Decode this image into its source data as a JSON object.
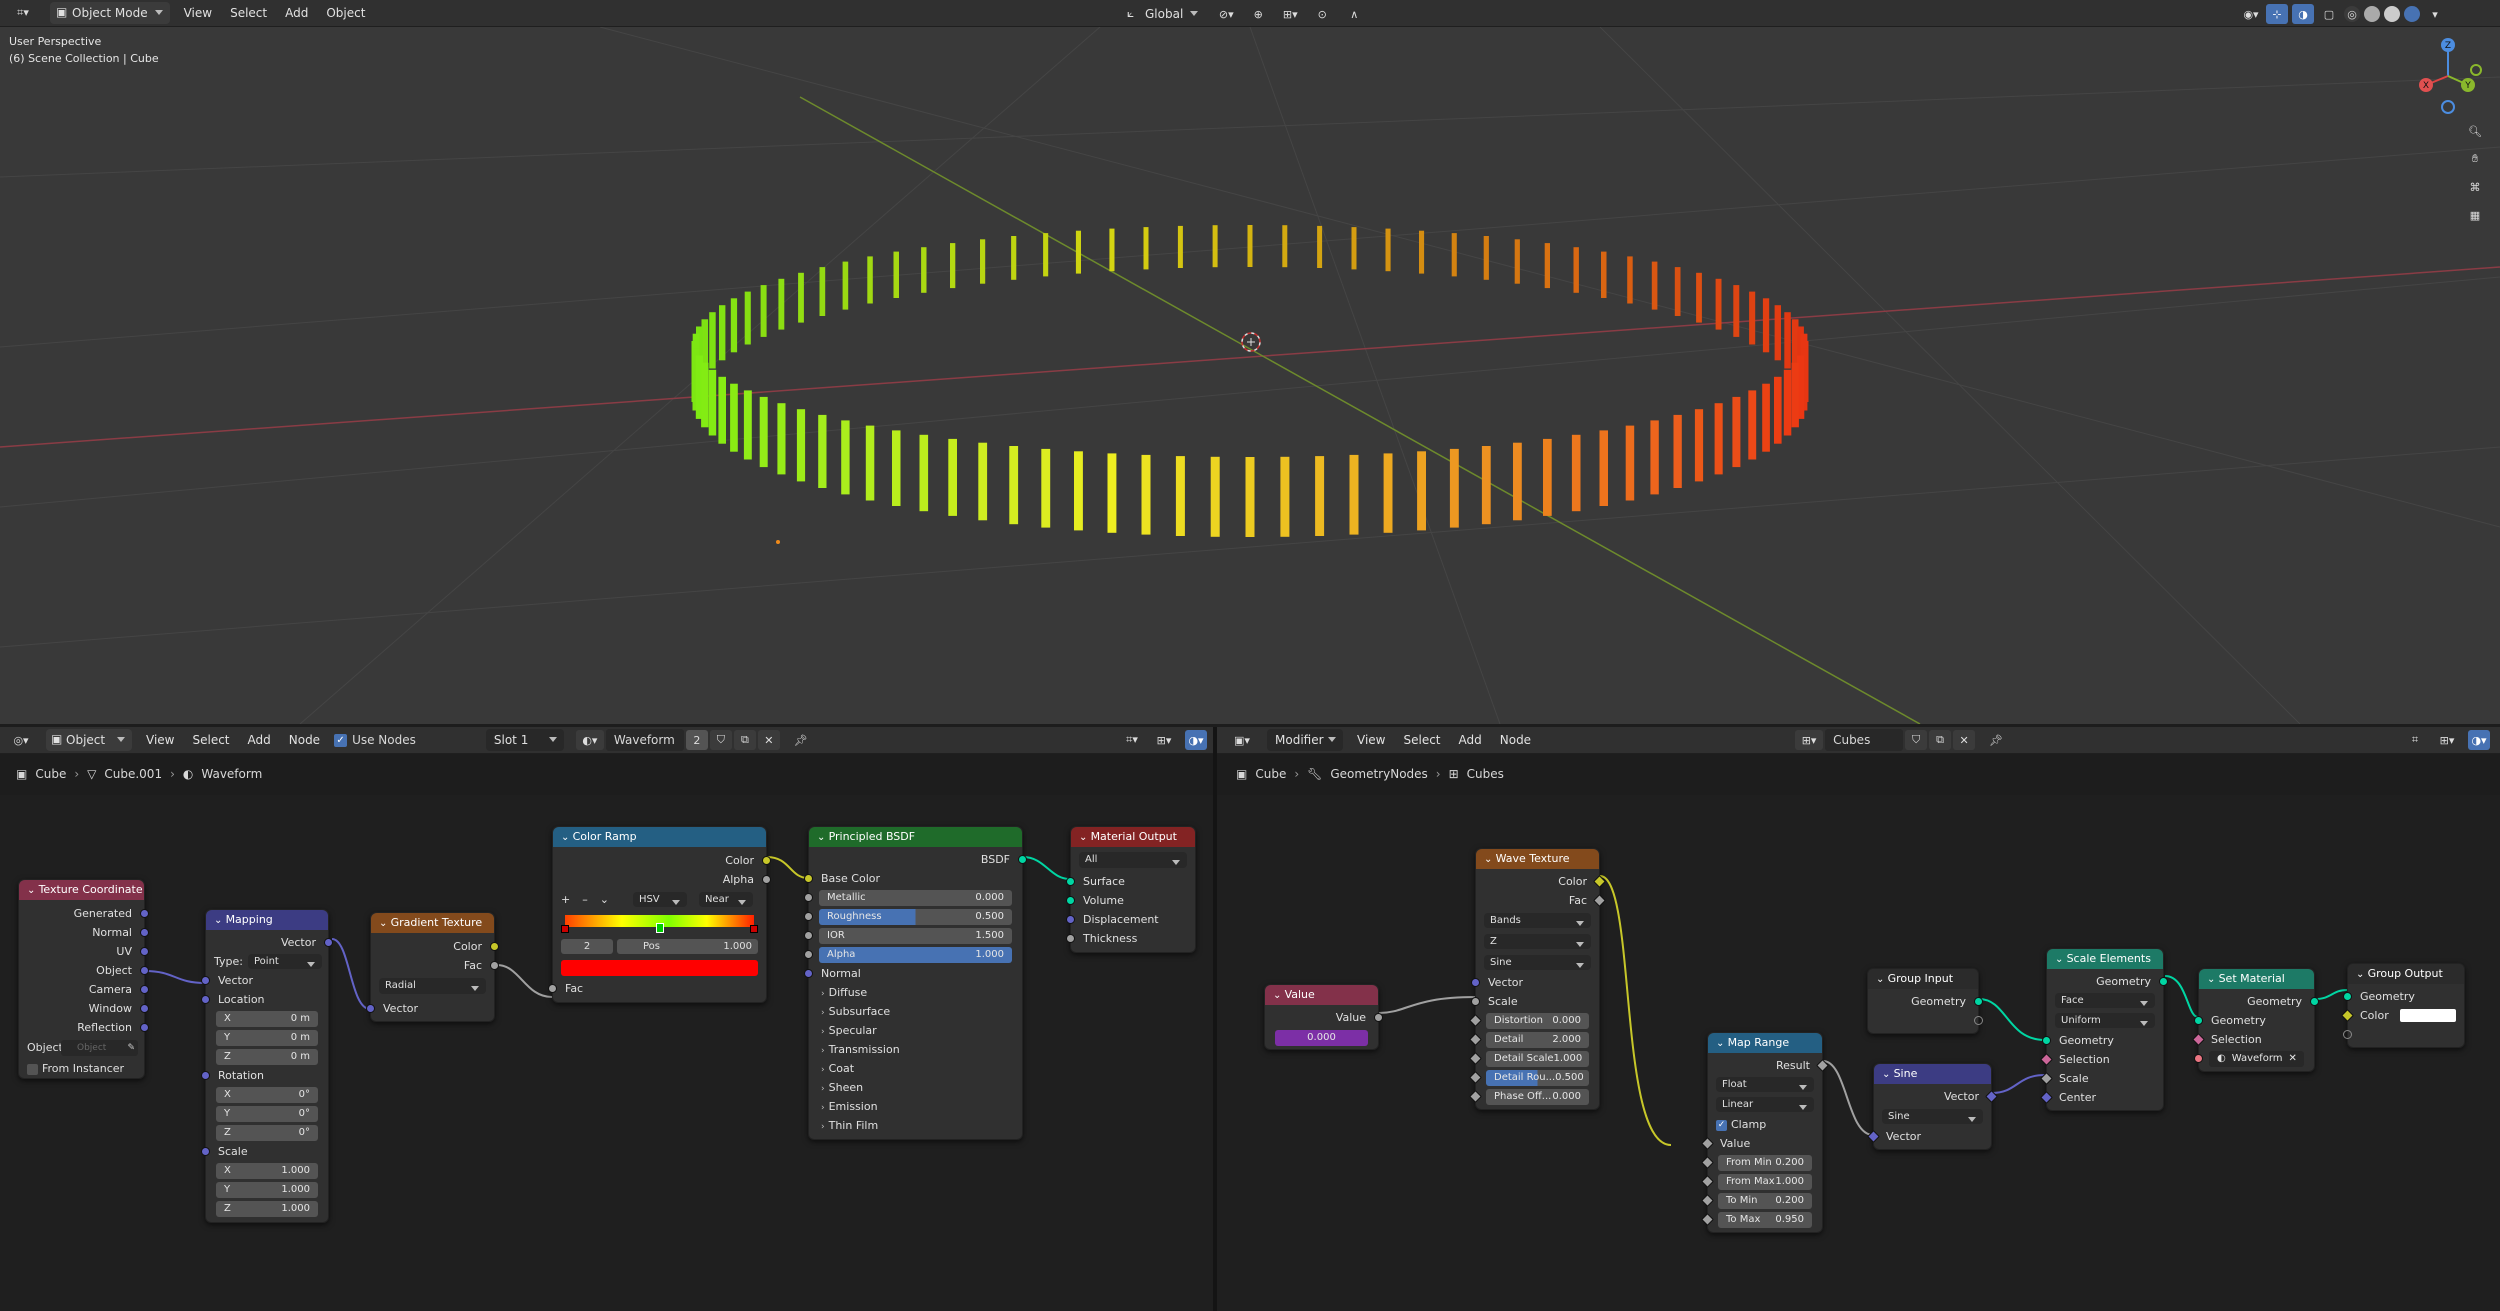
{
  "top_header": {
    "mode": "Object Mode",
    "menus": [
      "View",
      "Select",
      "Add",
      "Object"
    ],
    "orientation": "Global"
  },
  "viewport": {
    "perspective": "User Perspective",
    "collection": "(6) Scene Collection | Cube",
    "gizmo": {
      "x": "X",
      "y": "Y",
      "z": "Z"
    }
  },
  "shader_editor": {
    "object_dropdown": "Object",
    "menus": [
      "View",
      "Select",
      "Add",
      "Node"
    ],
    "use_nodes_label": "Use Nodes",
    "slot": "Slot 1",
    "material": "Waveform",
    "users": "2",
    "breadcrumb": [
      "Cube",
      "Cube.001",
      "Waveform"
    ],
    "nodes": {
      "texcoord": {
        "title": "Texture Coordinate",
        "outputs": [
          "Generated",
          "Normal",
          "UV",
          "Object",
          "Camera",
          "Window",
          "Reflection"
        ],
        "object_label": "Object:",
        "object_placeholder": "Object",
        "from_instancer": "From Instancer"
      },
      "mapping": {
        "title": "Mapping",
        "output": "Vector",
        "type_label": "Type:",
        "type_value": "Point",
        "input_vector": "Vector",
        "location": "Location",
        "loc": [
          [
            "X",
            "0 m"
          ],
          [
            "Y",
            "0 m"
          ],
          [
            "Z",
            "0 m"
          ]
        ],
        "rotation": "Rotation",
        "rot": [
          [
            "X",
            "0°"
          ],
          [
            "Y",
            "0°"
          ],
          [
            "Z",
            "0°"
          ]
        ],
        "scale": "Scale",
        "scl": [
          [
            "X",
            "1.000"
          ],
          [
            "Y",
            "1.000"
          ],
          [
            "Z",
            "1.000"
          ]
        ]
      },
      "gradient": {
        "title": "Gradient Texture",
        "out_color": "Color",
        "out_fac": "Fac",
        "type": "Radial",
        "in_vector": "Vector"
      },
      "colorramp": {
        "title": "Color Ramp",
        "out_color": "Color",
        "out_alpha": "Alpha",
        "mode": "HSV",
        "interp": "Near",
        "index": "2",
        "pos_label": "Pos",
        "pos_value": "1.000",
        "in_fac": "Fac",
        "add": "+",
        "remove": "–"
      },
      "bsdf": {
        "title": "Principled BSDF",
        "out": "BSDF",
        "base_color": "Base Color",
        "fields": [
          [
            "Metallic",
            "0.000"
          ],
          [
            "Roughness",
            "0.500"
          ],
          [
            "IOR",
            "1.500"
          ],
          [
            "Alpha",
            "1.000"
          ]
        ],
        "normal": "Normal",
        "panels": [
          "Diffuse",
          "Subsurface",
          "Specular",
          "Transmission",
          "Coat",
          "Sheen",
          "Emission",
          "Thin Film"
        ]
      },
      "matout": {
        "title": "Material Output",
        "target": "All",
        "inputs": [
          "Surface",
          "Volume",
          "Displacement",
          "Thickness"
        ]
      }
    }
  },
  "geo_editor": {
    "type_dropdown": "Modifier",
    "menus": [
      "View",
      "Select",
      "Add",
      "Node"
    ],
    "tree_name": "Cubes",
    "breadcrumb": [
      "Cube",
      "GeometryNodes",
      "Cubes"
    ],
    "nodes": {
      "value": {
        "title": "Value",
        "output": "Value",
        "value": "0.000"
      },
      "wave": {
        "title": "Wave Texture",
        "out_color": "Color",
        "out_fac": "Fac",
        "type": "Bands",
        "direction": "Z",
        "profile": "Sine",
        "in_vector": "Vector",
        "in_scale": "Scale",
        "fields": [
          [
            "Distortion",
            "0.000"
          ],
          [
            "Detail",
            "2.000"
          ],
          [
            "Detail Scale",
            "1.000"
          ],
          [
            "Detail Rou...",
            "0.500"
          ],
          [
            "Phase Off...",
            "0.000"
          ]
        ]
      },
      "maprange": {
        "title": "Map Range",
        "out": "Result",
        "dtype": "Float",
        "interp": "Linear",
        "clamp": "Clamp",
        "in_value": "Value",
        "fields": [
          [
            "From Min",
            "0.200"
          ],
          [
            "From Max",
            "1.000"
          ],
          [
            "To Min",
            "0.200"
          ],
          [
            "To Max",
            "0.950"
          ]
        ]
      },
      "groupin": {
        "title": "Group Input",
        "out": "Geometry"
      },
      "sine": {
        "title": "Sine",
        "out": "Vector",
        "op": "Sine",
        "in": "Vector"
      },
      "scale": {
        "title": "Scale Elements",
        "out": "Geometry",
        "domain": "Face",
        "mode": "Uniform",
        "inputs": [
          "Geometry",
          "Selection",
          "Scale",
          "Center"
        ]
      },
      "setmat": {
        "title": "Set Material",
        "out": "Geometry",
        "inputs": [
          "Geometry",
          "Selection"
        ],
        "material": "Waveform"
      },
      "groupout": {
        "title": "Group Output",
        "inputs": [
          "Geometry",
          "Color"
        ]
      }
    }
  }
}
